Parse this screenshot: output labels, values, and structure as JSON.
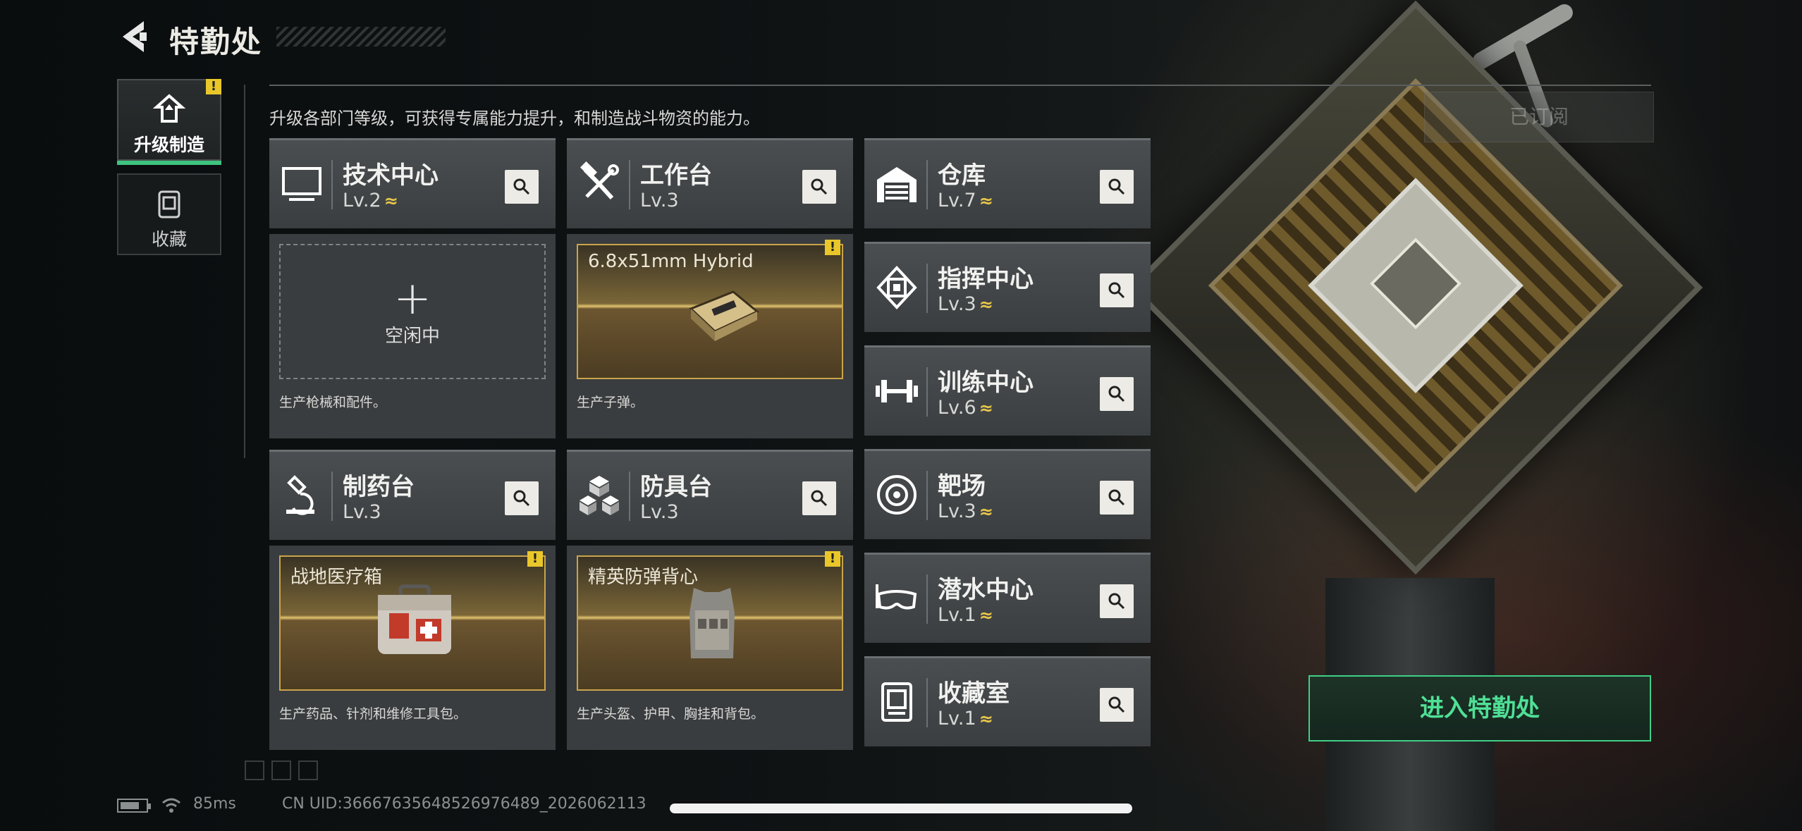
{
  "header": {
    "title": "特勤处"
  },
  "tabs": [
    {
      "label": "升级制造",
      "alert": "!"
    },
    {
      "label": "收藏"
    }
  ],
  "intro": "升级各部门等级，可获得专属能力提升，和制造战斗物资的能力。",
  "subscribe_label": "已订阅",
  "departments": {
    "tech": {
      "name": "技术中心",
      "level": "Lv.2",
      "upgradable": true,
      "slot_state": "空闲中",
      "description": "生产枪械和配件。"
    },
    "bench": {
      "name": "工作台",
      "level": "Lv.3",
      "upgradable": false,
      "item": "6.8x51mm Hybrid",
      "alert": "!",
      "description": "生产子弹。"
    },
    "pharma": {
      "name": "制药台",
      "level": "Lv.3",
      "upgradable": false,
      "item": "战地医疗箱",
      "alert": "!",
      "description": "生产药品、针剂和维修工具包。"
    },
    "armor": {
      "name": "防具台",
      "level": "Lv.3",
      "upgradable": false,
      "item": "精英防弹背心",
      "alert": "!",
      "description": "生产头盔、护甲、胸挂和背包。"
    }
  },
  "right_list": [
    {
      "name": "仓库",
      "level": "Lv.7",
      "icon": "warehouse-icon"
    },
    {
      "name": "指挥中心",
      "level": "Lv.3",
      "icon": "command-icon"
    },
    {
      "name": "训练中心",
      "level": "Lv.6",
      "icon": "dumbbell-icon"
    },
    {
      "name": "靶场",
      "level": "Lv.3",
      "icon": "target-icon"
    },
    {
      "name": "潜水中心",
      "level": "Lv.1",
      "icon": "diving-mask-icon"
    },
    {
      "name": "收藏室",
      "level": "Lv.1",
      "icon": "collection-icon"
    }
  ],
  "upgrade_glyph": "≈",
  "enter_label": "进入特勤处",
  "status": {
    "ping": "85ms",
    "uid": "CN UID:3666763564852697648​9_2026062113"
  },
  "colors": {
    "accent": "#3fcf86",
    "alert": "#e9c72a",
    "upgrade": "#e8c64a"
  }
}
